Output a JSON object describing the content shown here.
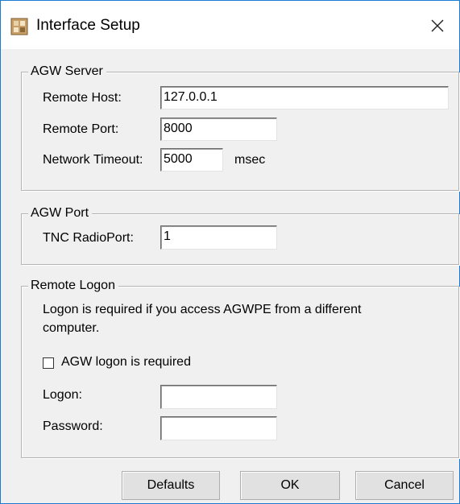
{
  "window": {
    "title": "Interface Setup"
  },
  "agw_server": {
    "legend": "AGW Server",
    "remote_host_label": "Remote Host:",
    "remote_host_value": "127.0.0.1",
    "remote_port_label": "Remote Port:",
    "remote_port_value": "8000",
    "network_timeout_label": "Network Timeout:",
    "network_timeout_value": "5000",
    "network_timeout_unit": "msec"
  },
  "agw_port": {
    "legend": "AGW Port",
    "tnc_radioport_label": "TNC RadioPort:",
    "tnc_radioport_value": "1"
  },
  "remote_logon": {
    "legend": "Remote Logon",
    "note_line1": "Logon is required if you access AGWPE from a different",
    "note_line2": "computer.",
    "checkbox_label": "AGW logon is required",
    "checkbox_checked": false,
    "logon_label": "Logon:",
    "logon_value": "",
    "password_label": "Password:",
    "password_value": ""
  },
  "buttons": {
    "defaults_label": "Defaults",
    "ok_label": "OK",
    "cancel_label": "Cancel"
  },
  "icons": {
    "app": "app-icon",
    "close": "close-icon"
  }
}
